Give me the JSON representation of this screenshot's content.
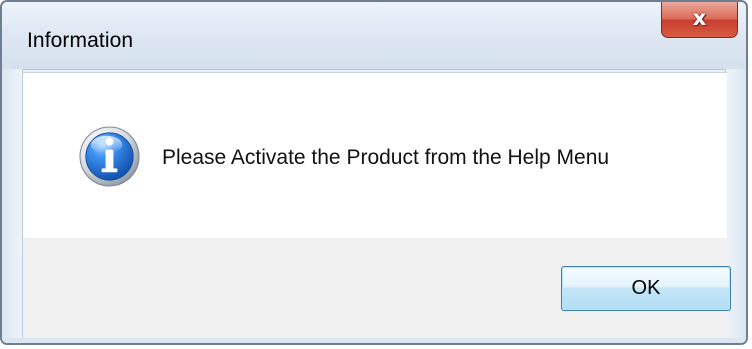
{
  "window": {
    "title": "Information",
    "close_label": "x"
  },
  "message": {
    "text": "Please Activate the Product from the Help Menu",
    "icon": "information-icon"
  },
  "buttons": {
    "ok_label": "OK"
  },
  "colors": {
    "close_button": "#d65c42",
    "ok_border": "#3c7fb1",
    "info_icon_blue": "#2f73cf"
  }
}
